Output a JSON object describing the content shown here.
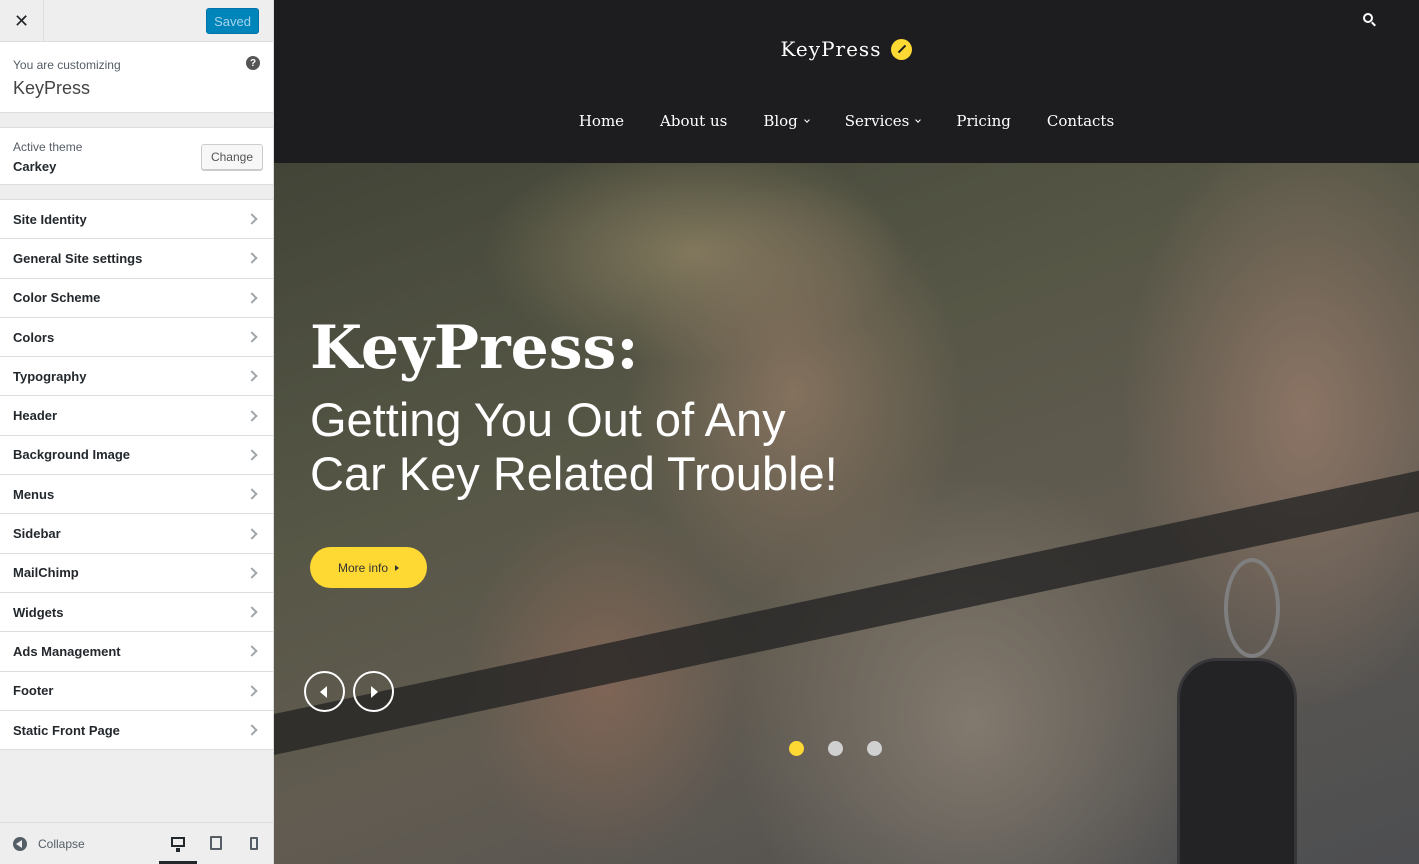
{
  "sidebar": {
    "close_glyph": "✕",
    "saved_label": "Saved",
    "info_small": "You are customizing",
    "info_title": "KeyPress",
    "help_glyph": "?",
    "theme_small": "Active theme",
    "theme_name": "Carkey",
    "change_label": "Change",
    "items": [
      {
        "label": "Site Identity"
      },
      {
        "label": "General Site settings"
      },
      {
        "label": "Color Scheme"
      },
      {
        "label": "Colors"
      },
      {
        "label": "Typography"
      },
      {
        "label": "Header"
      },
      {
        "label": "Background Image"
      },
      {
        "label": "Menus"
      },
      {
        "label": "Sidebar"
      },
      {
        "label": "MailChimp"
      },
      {
        "label": "Widgets"
      },
      {
        "label": "Ads Management"
      },
      {
        "label": "Footer"
      },
      {
        "label": "Static Front Page"
      }
    ],
    "collapse_label": "Collapse",
    "preview_device": "desktop"
  },
  "site": {
    "logo_text": "KeyPress",
    "nav": [
      {
        "label": "Home"
      },
      {
        "label": "About us"
      },
      {
        "label": "Blog"
      },
      {
        "label": "Services"
      },
      {
        "label": "Pricing"
      },
      {
        "label": "Contacts"
      }
    ],
    "hero_title": "KeyPress:",
    "hero_sub_line1": "Getting You Out of Any",
    "hero_sub_line2": "Car Key Related Trouble!",
    "more_info_label": "More info",
    "slide_active_index": 0,
    "slide_count": 3
  },
  "colors": {
    "accent": "#ffd933",
    "header_bg": "#1d1d1f",
    "saved_button": "#0085ba"
  },
  "icons": [
    "close-icon",
    "help-icon",
    "chevron-right-icon",
    "collapse-icon",
    "desktop-icon",
    "tablet-icon",
    "mobile-icon",
    "search-icon",
    "key-logo-icon",
    "prev-arrow-icon",
    "next-arrow-icon"
  ]
}
